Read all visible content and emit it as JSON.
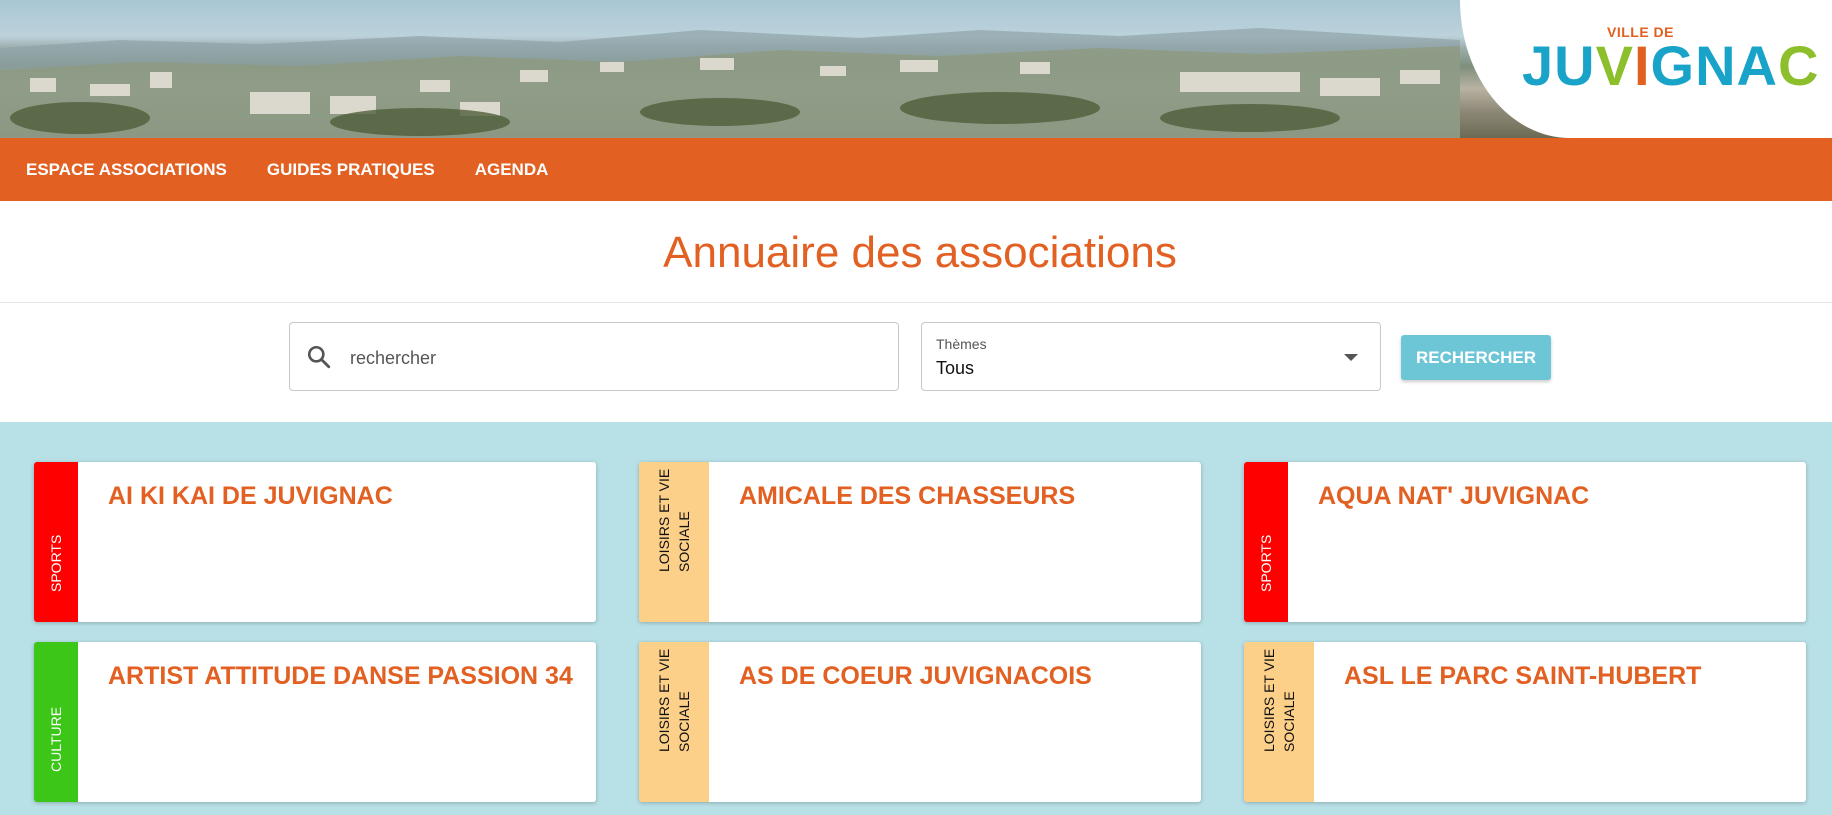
{
  "logo": {
    "small": "VILLE DE",
    "letters": [
      {
        "ch": "J",
        "color": "#1aa3c8"
      },
      {
        "ch": "U",
        "color": "#1aa3c8"
      },
      {
        "ch": "V",
        "color": "#8cbf2b"
      },
      {
        "ch": "I",
        "color": "#e2601f"
      },
      {
        "ch": "G",
        "color": "#1aa3c8"
      },
      {
        "ch": "N",
        "color": "#1aa3c8"
      },
      {
        "ch": "A",
        "color": "#1aa3c8"
      },
      {
        "ch": "C",
        "color": "#8cbf2b"
      }
    ]
  },
  "nav": {
    "items": [
      "ESPACE ASSOCIATIONS",
      "GUIDES PRATIQUES",
      "AGENDA"
    ]
  },
  "page": {
    "title": "Annuaire des associations"
  },
  "search": {
    "placeholder": "rechercher",
    "icon": "search-icon"
  },
  "themes": {
    "label": "Thèmes",
    "selected": "Tous"
  },
  "search_button": {
    "label": "RECHERCHER"
  },
  "colors": {
    "brand": "#e26022",
    "button": "#6cc6d6",
    "area": "#b8e1e7",
    "sports": "#ff0000",
    "loisirs": "#fdd08a",
    "culture": "#3cc618"
  },
  "cards": [
    {
      "name": "AI KI KAI DE JUVIGNAC",
      "theme": "SPORTS",
      "theme_color": "#ff0000",
      "theme_text_color": "#ffffff"
    },
    {
      "name": "AMICALE DES CHASSEURS",
      "theme": "LOISIRS ET VIE SOCIALE",
      "theme_color": "#fdd08a",
      "theme_text_color": "#111111"
    },
    {
      "name": "AQUA NAT' JUVIGNAC",
      "theme": "SPORTS",
      "theme_color": "#ff0000",
      "theme_text_color": "#ffffff"
    },
    {
      "name": "ARTIST ATTITUDE DANSE PASSION 34",
      "theme": "CULTURE",
      "theme_color": "#3cc618",
      "theme_text_color": "#ffffff"
    },
    {
      "name": "AS DE COEUR JUVIGNACOIS",
      "theme": "LOISIRS ET VIE SOCIALE",
      "theme_color": "#fdd08a",
      "theme_text_color": "#111111"
    },
    {
      "name": "ASL LE PARC SAINT-HUBERT",
      "theme": "LOISIRS ET VIE SOCIALE",
      "theme_color": "#fdd08a",
      "theme_text_color": "#111111"
    }
  ]
}
